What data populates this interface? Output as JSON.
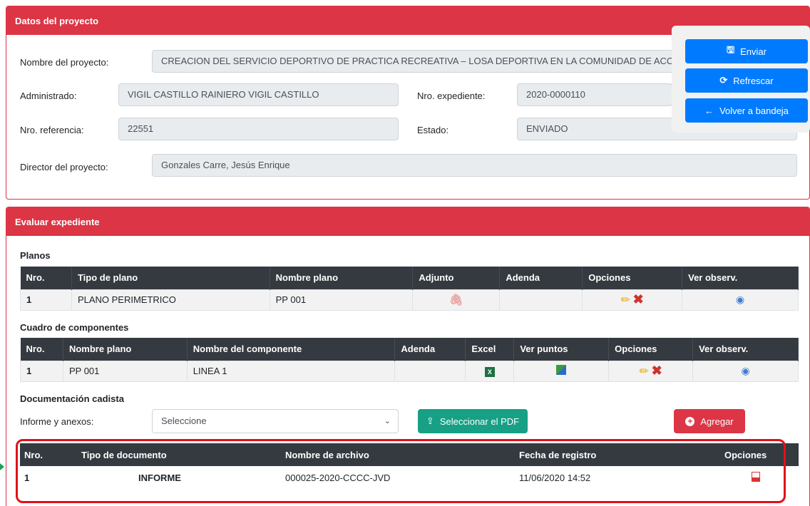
{
  "proyecto": {
    "header": "Datos del proyecto",
    "nombre_label": "Nombre del proyecto:",
    "nombre_value": "CREACION DEL SERVICIO DEPORTIVO DE PRACTICA RECREATIVA – LOSA DEPORTIVA EN LA COMUNIDAD DE ACCOLLO PALLA DEL DI",
    "administrado_label": "Administrado:",
    "administrado_value": "VIGIL CASTILLO RAINIERO VIGIL CASTILLO",
    "expediente_label": "Nro. expediente:",
    "expediente_value": "2020-0000110",
    "referencia_label": "Nro. referencia:",
    "referencia_value": "22551",
    "estado_label": "Estado:",
    "estado_value": "ENVIADO",
    "director_label": "Director del proyecto:",
    "director_value": "Gonzales Carre, Jesús Enrique"
  },
  "actions": {
    "enviar": "Enviar",
    "refrescar": "Refrescar",
    "volver": "Volver a bandeja"
  },
  "evaluar": {
    "header": "Evaluar expediente",
    "planos_title": "Planos",
    "planos_headers": [
      "Nro.",
      "Tipo de plano",
      "Nombre plano",
      "Adjunto",
      "Adenda",
      "Opciones",
      "Ver observ."
    ],
    "planos_rows": [
      {
        "nro": "1",
        "tipo": "PLANO PERIMETRICO",
        "nombre": "PP 001"
      }
    ],
    "componentes_title": "Cuadro de componentes",
    "componentes_headers": [
      "Nro.",
      "Nombre plano",
      "Nombre del componente",
      "Adenda",
      "Excel",
      "Ver puntos",
      "Opciones",
      "Ver observ."
    ],
    "componentes_rows": [
      {
        "nro": "1",
        "plano": "PP 001",
        "componente": "LINEA 1"
      }
    ],
    "doc_title": "Documentación cadista",
    "informe_label": "Informe y anexos:",
    "select_value": "Seleccione",
    "seleccionar_pdf": "Seleccionar el PDF",
    "agregar": "Agregar",
    "doc_headers": [
      "Nro.",
      "Tipo de documento",
      "Nombre de archivo",
      "Fecha de registro",
      "Opciones"
    ],
    "doc_rows": [
      {
        "nro": "1",
        "tipo": "INFORME",
        "archivo": "000025-2020-CCCC-JVD",
        "fecha": "11/06/2020 14:52"
      }
    ]
  },
  "colors": {
    "primary": "#007bff",
    "danger": "#dc3545",
    "success": "#17a085",
    "dark": "#343a40"
  }
}
